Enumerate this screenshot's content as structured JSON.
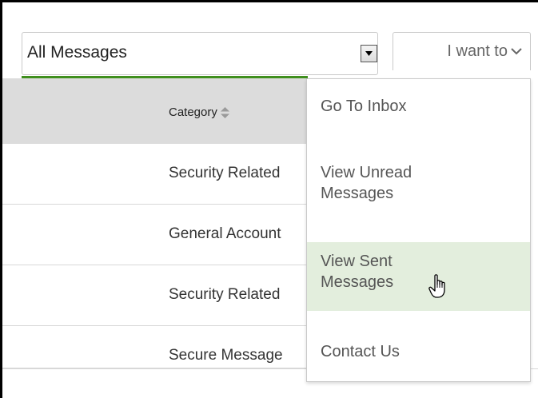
{
  "filter": {
    "value": "All Messages"
  },
  "actions": {
    "label": "I want to"
  },
  "table": {
    "header": {
      "category": "Category"
    },
    "rows": [
      {
        "category": "Security Related"
      },
      {
        "category": "General Account"
      },
      {
        "category": "Security Related"
      },
      {
        "category": "Secure Message"
      }
    ]
  },
  "menu": {
    "items": [
      {
        "label": "Go To Inbox"
      },
      {
        "label": "View Unread Messages"
      },
      {
        "label": "View Sent Messages"
      },
      {
        "label": "Contact Us"
      }
    ],
    "hovered_index": 2
  },
  "colors": {
    "accent_green": "#3f8f1e",
    "hover_bg": "#e3eedd",
    "header_bg": "#dcdcdc"
  }
}
